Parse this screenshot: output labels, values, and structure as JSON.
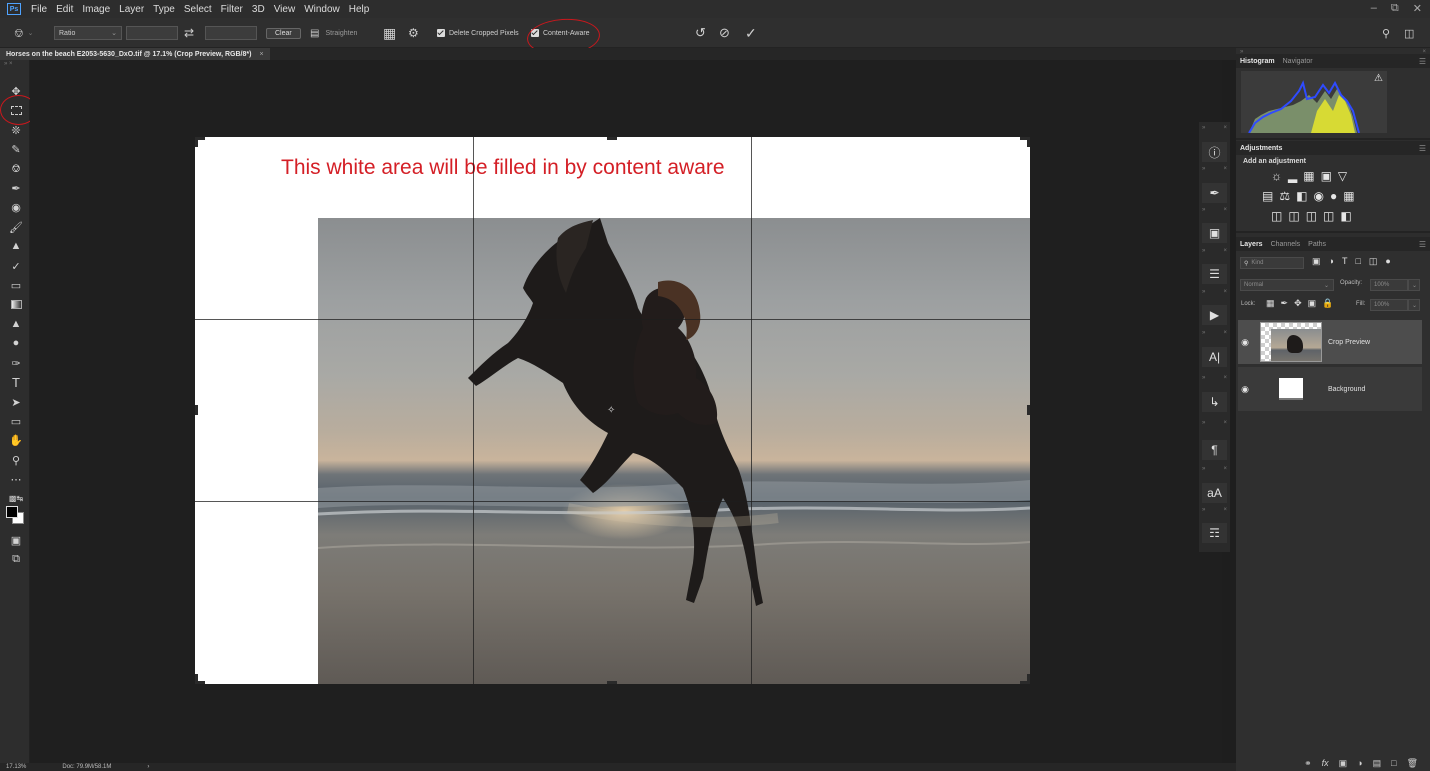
{
  "app": {
    "logo": "Ps",
    "menu": [
      "File",
      "Edit",
      "Image",
      "Layer",
      "Type",
      "Select",
      "Filter",
      "3D",
      "View",
      "Window",
      "Help"
    ],
    "window_controls": [
      "minimize-icon",
      "restore-icon",
      "close-icon"
    ]
  },
  "options_bar": {
    "ratio": "Ratio",
    "clear_label": "Clear",
    "straighten_label": "Straighten",
    "delete_cropped_pixels": "Delete Cropped Pixels",
    "content_aware": "Content-Aware",
    "delete_cropped_checked": true,
    "content_aware_checked": true
  },
  "document": {
    "tab_title": "Horses on the beach E2053-5630_DxO.tif @ 17.1% (Crop Preview, RGB/8*)",
    "annotation": "This white area will be filled in by content aware"
  },
  "status": {
    "zoom": "17.13%",
    "doc": "Doc: 79.9M/58.1M"
  },
  "panels": {
    "histogram_tabs": [
      "Histogram",
      "Navigator"
    ],
    "adjustments_title": "Adjustments",
    "adjustments_subtitle": "Add an adjustment",
    "layers_tabs": [
      "Layers",
      "Channels",
      "Paths"
    ],
    "kind": "Kind",
    "blend_mode": "Normal",
    "opacity_label": "Opacity:",
    "opacity_value": "100%",
    "lock_label": "Lock:",
    "fill_label": "Fill:",
    "fill_value": "100%",
    "layers": [
      {
        "name": "Crop Preview",
        "selected": true
      },
      {
        "name": "Background",
        "selected": false
      }
    ]
  },
  "colors": {
    "annotation_red": "#d41f26",
    "highlight_red": "#c8181d",
    "ps_blue": "#4fa3ff"
  }
}
